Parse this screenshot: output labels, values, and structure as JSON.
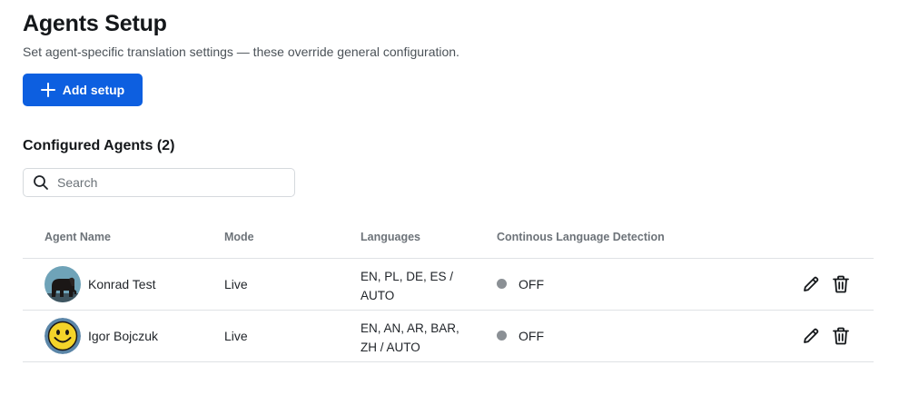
{
  "header": {
    "title": "Agents Setup",
    "subtitle": "Set agent-specific translation settings — these override general configuration.",
    "add_button_label": "Add setup"
  },
  "section": {
    "title": "Configured Agents (2)"
  },
  "search": {
    "placeholder": "Search",
    "value": "",
    "icon": "search-icon"
  },
  "table": {
    "columns": [
      "Agent Name",
      "Mode",
      "Languages",
      "Continous Language Detection"
    ],
    "rows": [
      {
        "name": "Konrad Test",
        "avatar": "elephant-avatar",
        "mode": "Live",
        "languages_line1": "EN, PL, DE, ES /",
        "languages_line2": "AUTO",
        "detection": "OFF",
        "status_color": "#8b9095"
      },
      {
        "name": "Igor Bojczuk",
        "avatar": "smiley-avatar",
        "mode": "Live",
        "languages_line1": "EN, AN, AR, BAR,",
        "languages_line2": "ZH / AUTO",
        "detection": "OFF",
        "status_color": "#8b9095"
      }
    ],
    "row_actions": [
      "pencil-icon",
      "trash-icon"
    ]
  },
  "colors": {
    "accent": "#0d5fe0",
    "border": "#dfe2e5",
    "muted_text": "#6d7379",
    "status_off": "#8b9095"
  }
}
